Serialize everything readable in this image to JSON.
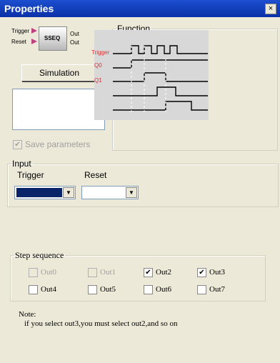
{
  "window": {
    "title": "Properties",
    "close_symbol": "×"
  },
  "block": {
    "name": "SSEQ",
    "inputs": [
      "Trigger",
      "Reset"
    ],
    "outputs": [
      "Out",
      "Out"
    ]
  },
  "simulation_button": "Simulation",
  "save_parameters": {
    "label": "Save parameters",
    "checked": true,
    "enabled": false
  },
  "function": {
    "legend": "Function",
    "signals": [
      "Trigger",
      "Q0",
      "Q1"
    ]
  },
  "input": {
    "legend": "Input",
    "trigger_label": "Trigger",
    "reset_label": "Reset",
    "trigger_value": "",
    "reset_value": ""
  },
  "step_sequence": {
    "legend": "Step sequence",
    "items": [
      {
        "label": "Out0",
        "checked": false,
        "enabled": false
      },
      {
        "label": "Out1",
        "checked": false,
        "enabled": false
      },
      {
        "label": "Out2",
        "checked": true,
        "enabled": true
      },
      {
        "label": "Out3",
        "checked": true,
        "enabled": true
      },
      {
        "label": "Out4",
        "checked": false,
        "enabled": true
      },
      {
        "label": "Out5",
        "checked": false,
        "enabled": true
      },
      {
        "label": "Out6",
        "checked": false,
        "enabled": true
      },
      {
        "label": "Out7",
        "checked": false,
        "enabled": true
      }
    ]
  },
  "note": {
    "title": "Note:",
    "text": "if you select out3,you must select out2,and so on"
  },
  "colors": {
    "titlebar": "#0a30a8",
    "signal_label": "#e03030",
    "trigger_select": "#0a246a"
  }
}
